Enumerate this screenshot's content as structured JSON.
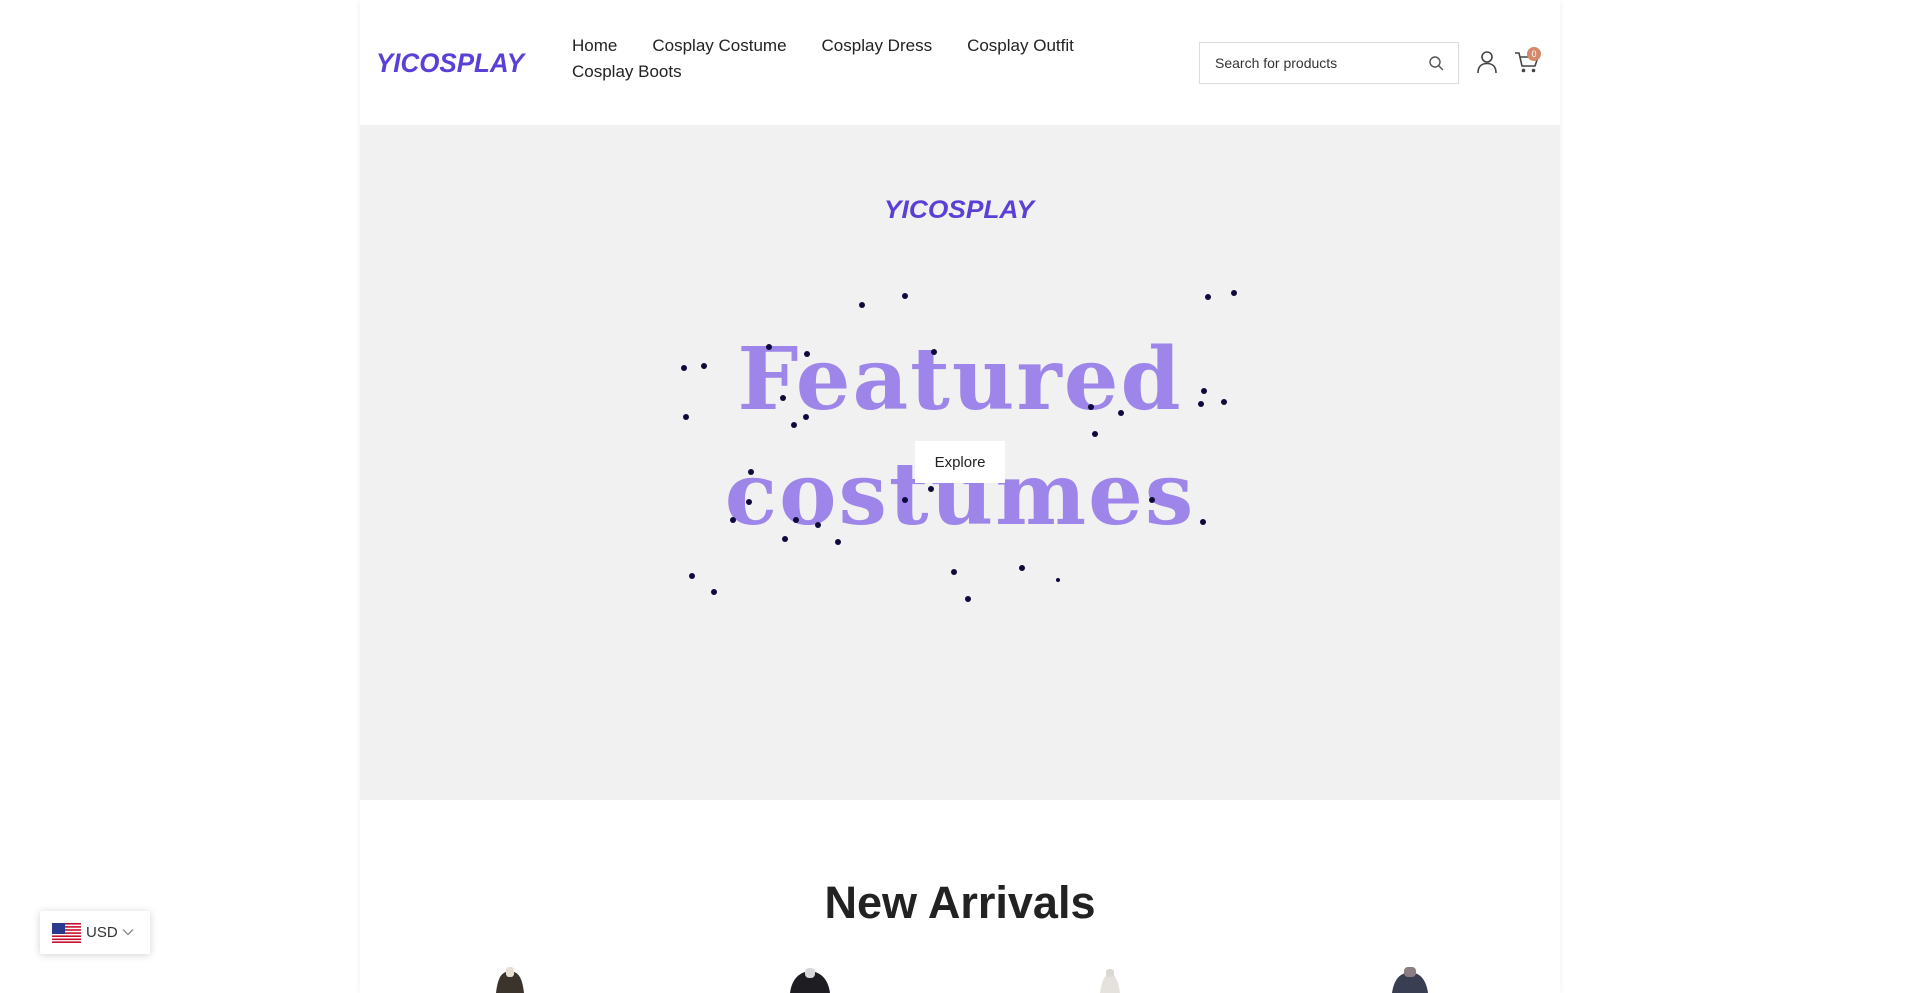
{
  "header": {
    "logo_text": "YICOSPLAY",
    "nav": [
      {
        "label": "Home"
      },
      {
        "label": "Cosplay Costume"
      },
      {
        "label": "Cosplay Dress"
      },
      {
        "label": "Cosplay Outfit"
      },
      {
        "label": "Cosplay Boots"
      }
    ],
    "search_placeholder": "Search for products",
    "cart_count": "0",
    "icons": {
      "search": "search-icon",
      "user": "user-icon",
      "cart": "cart-icon"
    }
  },
  "hero": {
    "logo_text": "YICOSPLAY",
    "line1": "Featured",
    "line2": "costumes",
    "button_label": "Explore"
  },
  "new_arrivals": {
    "title": "New Arrivals"
  },
  "currency": {
    "code": "USD",
    "flag": "us-flag-icon"
  },
  "colors": {
    "brand_purple": "#5b3fd6",
    "hero_text": "#9d85ea",
    "hero_bg": "#f1f1f1",
    "dots": "#0f0a3c",
    "badge": "#d38a6a"
  }
}
